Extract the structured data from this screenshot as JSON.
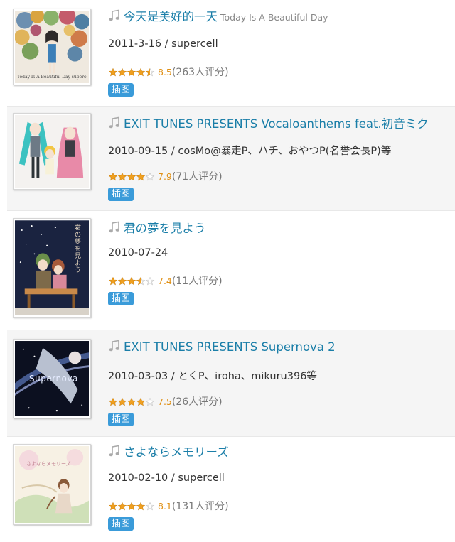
{
  "albums": [
    {
      "title": "今天是美好的一天",
      "subtitle": "Today Is A Beautiful Day",
      "meta": "2011-3-16 / supercell",
      "score": "8.5",
      "count": "(263人评分)",
      "stars": 4.5,
      "tag": "插图",
      "cover_icon": "flower-girl-cover",
      "cover_text": "Today Is A Beautiful Day  supercell"
    },
    {
      "title": "EXIT TUNES PRESENTS Vocaloanthems feat.初音ミク",
      "subtitle": "",
      "meta": "2010-09-15 / cosMo@暴走P、ハチ、おやつP(名誉会長P)等",
      "score": "7.9",
      "count": "(71人评分)",
      "stars": 4,
      "tag": "插图",
      "cover_icon": "vocaloid-group-cover"
    },
    {
      "title": "君の夢を見よう",
      "subtitle": "",
      "meta": "2010-07-24",
      "score": "7.4",
      "count": "(11人评分)",
      "stars": 3.5,
      "tag": "插图",
      "cover_icon": "night-sky-cover",
      "cover_text": "君の夢を見よう"
    },
    {
      "title": "EXIT TUNES PRESENTS Supernova 2",
      "subtitle": "",
      "meta": "2010-03-03 / とくP、iroha、mikuru396等",
      "score": "7.5",
      "count": "(26人评分)",
      "stars": 4,
      "tag": "插图",
      "cover_icon": "supernova-cover",
      "cover_text": "Supernova"
    },
    {
      "title": "さよならメモリーズ",
      "subtitle": "",
      "meta": "2010-02-10 / supercell",
      "score": "8.1",
      "count": "(131人评分)",
      "stars": 4,
      "tag": "插图",
      "cover_icon": "sakura-memories-cover",
      "cover_text": "さよならメモリーズ"
    }
  ],
  "colors": {
    "link": "#1a7ea8",
    "tag_bg": "#3a9bd9",
    "star": "#f0a020",
    "score": "#e09015"
  }
}
